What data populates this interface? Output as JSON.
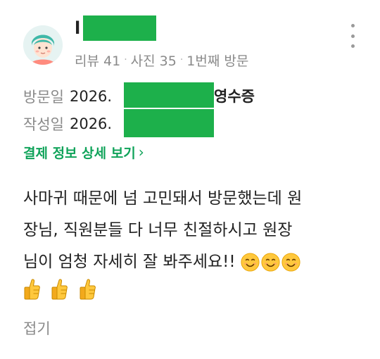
{
  "reviewer": {
    "name_visible": "l",
    "stats": {
      "reviews": "리뷰 41",
      "photos": "사진 35",
      "visit_count": "1번째 방문"
    }
  },
  "visit": {
    "label": "방문일",
    "date_prefix": "2026.",
    "receipt_label": "영수증"
  },
  "written": {
    "label": "작성일",
    "date_prefix": "2026."
  },
  "payment_link": {
    "label": "결제 정보 상세 보기",
    "chevron": "›"
  },
  "review": {
    "line1": "사마귀 때문에 넘 고민돼서 방문했는데 원",
    "line2": "장님, 직원분들 다 너무 친절하시고 원장",
    "line3": "님이 엄청 자세히 잘 봐주세요!!",
    "smile_count": 3,
    "thumbs_count": 3
  },
  "fold_label": "접기",
  "colors": {
    "accent_green": "#10a35a",
    "redaction": "#1db04b",
    "meta_gray": "#8a8a8a"
  },
  "icons": [
    "avatar-icon",
    "more-options-icon",
    "chevron-right-icon",
    "smiling-face-icon",
    "thumbs-up-icon"
  ]
}
